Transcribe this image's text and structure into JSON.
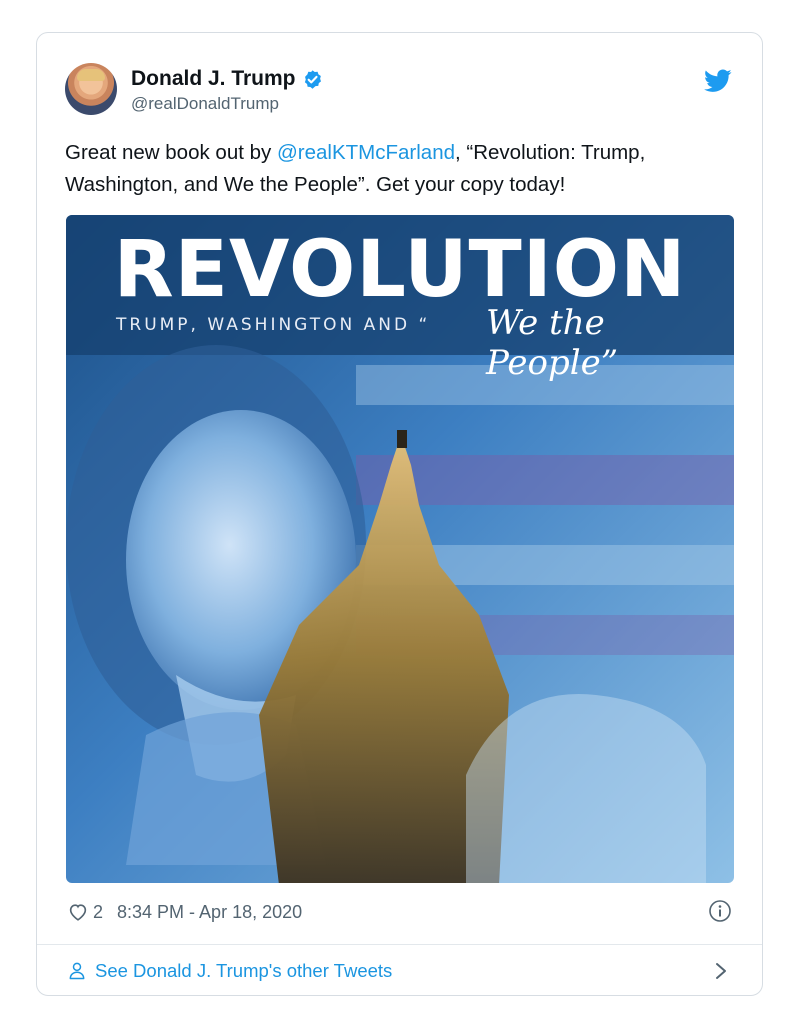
{
  "author": {
    "name": "Donald J. Trump",
    "handle": "@realDonaldTrump",
    "verified": true
  },
  "tweet": {
    "text_before": "Great new book out by ",
    "mention": "@realKTMcFarland",
    "text_after": ", “Revolution: Trump, Washington, and We the People”. Get your copy today!"
  },
  "media": {
    "cover_title": "REVOLUTION",
    "cover_subtitle": "TRUMP, WASHINGTON AND “",
    "cover_script": "We the People”"
  },
  "meta": {
    "likes": "2",
    "timestamp": "8:34 PM - Apr 18, 2020"
  },
  "footer": {
    "label": "See Donald J. Trump's other Tweets"
  },
  "colors": {
    "link": "#1b95e0",
    "verified": "#1d9bf0",
    "muted": "#536471"
  },
  "icons": [
    "verified-badge-icon",
    "twitter-bird-icon",
    "heart-icon",
    "info-icon",
    "person-icon",
    "chevron-right-icon"
  ]
}
